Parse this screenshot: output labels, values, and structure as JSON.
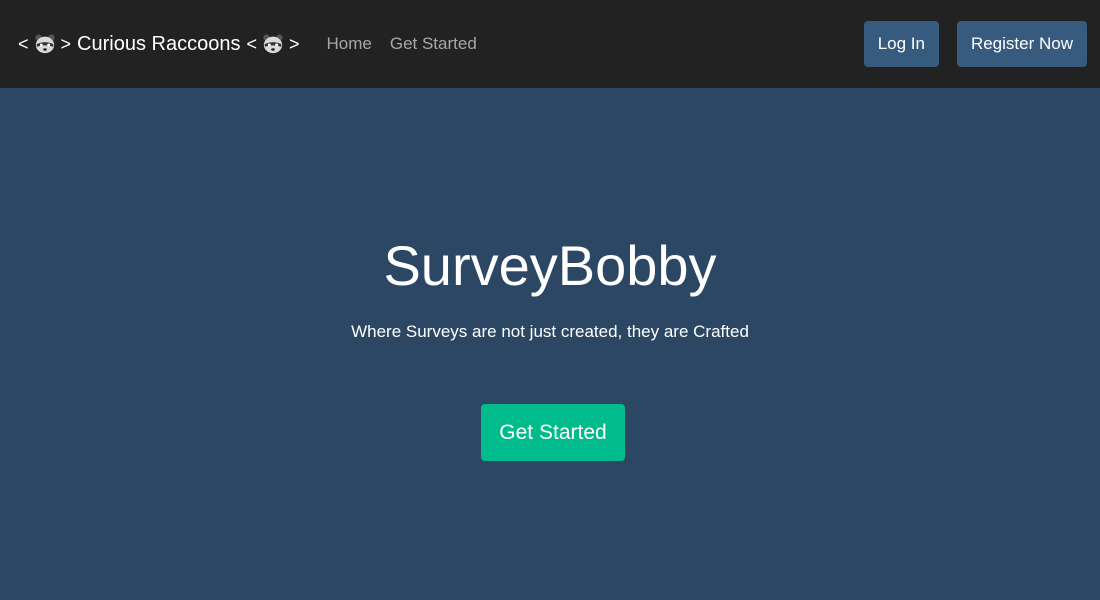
{
  "navbar": {
    "brand": {
      "left_symbol": "<",
      "name": "Curious Raccoons",
      "right_symbol": ">",
      "icon": "raccoon-icon"
    },
    "links": [
      {
        "label": "Home"
      },
      {
        "label": "Get Started"
      }
    ],
    "login_label": "Log In",
    "register_label": "Register Now"
  },
  "hero": {
    "title": "SurveyBobby",
    "subtitle": "Where Surveys are not just created, they are Crafted",
    "cta_label": "Get Started"
  },
  "colors": {
    "navbar_bg": "#222222",
    "hero_bg": "#2c4764",
    "nav_button": "#375a7f",
    "cta_button": "#00bc8c",
    "nav_link_text": "#a7a7a7"
  }
}
